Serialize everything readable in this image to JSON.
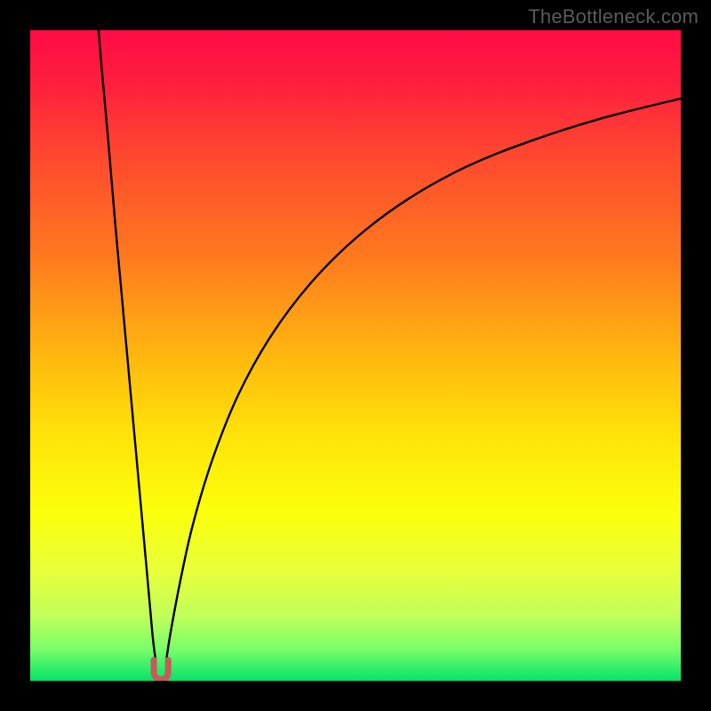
{
  "watermark": "TheBottleneck.com",
  "colors": {
    "frame": "#000000",
    "curve": "#000000",
    "marker_fill": "#c85a5a",
    "marker_stroke": "#b24848",
    "gradient_stops": [
      {
        "offset": 0.0,
        "color": "#ff0b46"
      },
      {
        "offset": 0.08,
        "color": "#ff1e3e"
      },
      {
        "offset": 0.2,
        "color": "#ff4a2e"
      },
      {
        "offset": 0.35,
        "color": "#ff7a1e"
      },
      {
        "offset": 0.5,
        "color": "#ffb70f"
      },
      {
        "offset": 0.62,
        "color": "#ffe209"
      },
      {
        "offset": 0.74,
        "color": "#fbff0a"
      },
      {
        "offset": 0.83,
        "color": "#e8ff3a"
      },
      {
        "offset": 0.9,
        "color": "#c1ff5a"
      },
      {
        "offset": 0.95,
        "color": "#7cff6a"
      },
      {
        "offset": 1.0,
        "color": "#05e36a"
      }
    ]
  },
  "chart_data": {
    "type": "line",
    "title": "",
    "xlabel": "",
    "ylabel": "",
    "xlim": [
      0,
      100
    ],
    "ylim": [
      0,
      100
    ],
    "minimum_x": 20,
    "series": [
      {
        "name": "left-branch",
        "x": [
          10.5,
          11,
          12,
          13,
          14,
          15,
          16,
          17,
          18,
          18.8,
          19.3
        ],
        "y": [
          100,
          94,
          83,
          71,
          60,
          49,
          38,
          27,
          16,
          7,
          3
        ]
      },
      {
        "name": "right-branch",
        "x": [
          20.9,
          21.5,
          23,
          25,
          28,
          32,
          37,
          43,
          50,
          58,
          67,
          77,
          88,
          100
        ],
        "y": [
          3,
          7,
          15,
          24,
          34,
          44,
          53,
          61,
          68,
          74,
          79,
          83,
          86.5,
          89.5
        ]
      }
    ],
    "marker": {
      "name": "minimum-marker",
      "shape": "u",
      "x_range": [
        19.0,
        21.2
      ],
      "y_range": [
        0.2,
        3.2
      ]
    }
  }
}
